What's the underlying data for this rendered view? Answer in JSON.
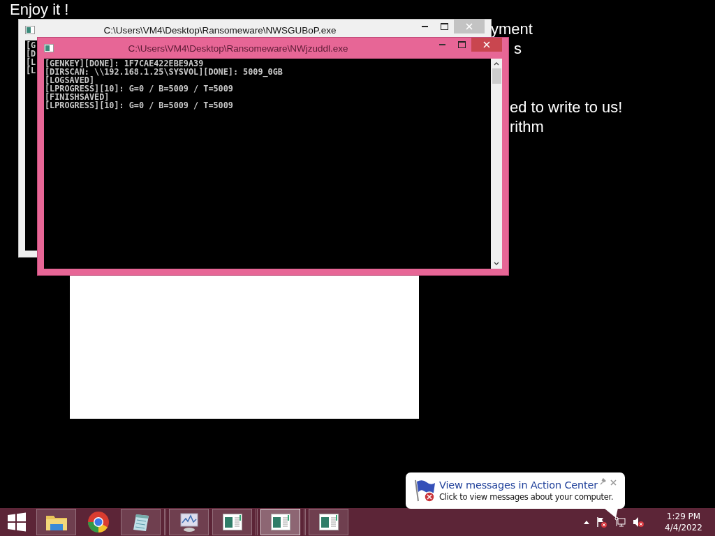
{
  "desktop_text": [
    "Enjoy it !",
    "yment",
    "s",
    "ed to write to us!",
    "rithm"
  ],
  "windows": [
    {
      "title": "C:\\Users\\VM4\\Desktop\\Ransomeware\\NWSGUBoP.exe",
      "active": false,
      "lines": [
        "[G",
        "[D",
        "[L",
        "[L"
      ]
    },
    {
      "title": "C:\\Users\\VM4\\Desktop\\Ransomeware\\NWjzuddl.exe",
      "active": true,
      "lines": [
        "[GENKEY][DONE]: 1F7CAE422EBE9A39",
        "[DIRSCAN: \\\\192.168.1.25\\SYSVOL][DONE]: 5009_0GB",
        "[LOGSAVED]",
        "[LPROGRESS][10]: G=0 / B=5009 / T=5009",
        "[FINISHSAVED]",
        "[LPROGRESS][10]: G=0 / B=5009 / T=5009"
      ]
    }
  ],
  "taskbar": {
    "items": [
      {
        "kind": "explorer",
        "selected": false
      },
      {
        "kind": "chrome",
        "selected": false
      },
      {
        "kind": "notepad",
        "selected": false
      },
      {
        "kind": "monitor",
        "selected": false
      },
      {
        "kind": "console",
        "selected": false
      },
      {
        "kind": "console",
        "selected": true
      },
      {
        "kind": "console",
        "selected": false
      }
    ],
    "clock": {
      "time": "1:29 PM",
      "date": "4/4/2022"
    }
  },
  "notification": {
    "title": "View messages in Action Center",
    "message": "Click to view messages about your computer."
  }
}
